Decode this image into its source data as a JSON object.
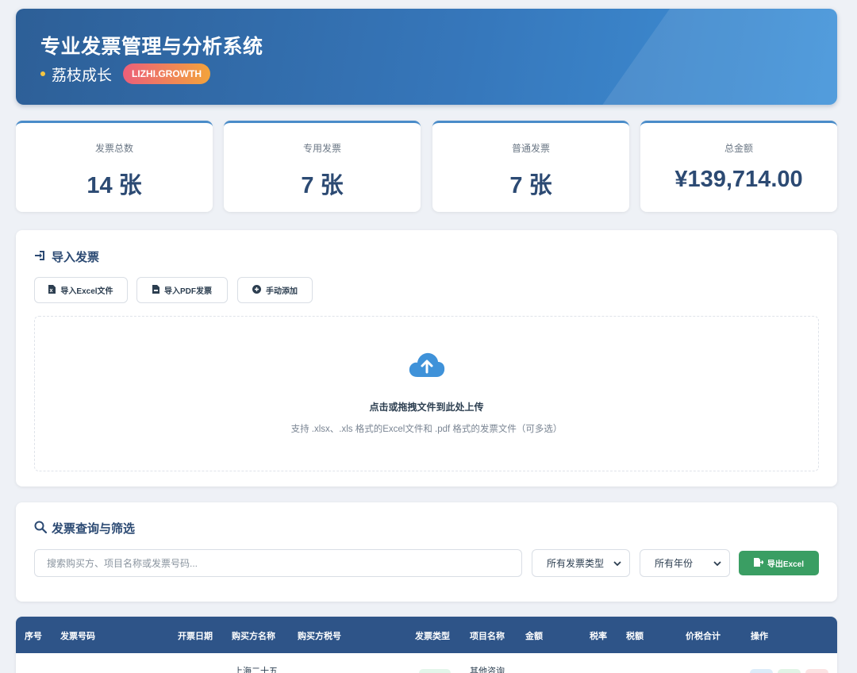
{
  "header": {
    "title": "专业发票管理与分析系统",
    "brand_name": "荔枝成长",
    "brand_badge": "LIZHI.GROWTH"
  },
  "stats": [
    {
      "label": "发票总数",
      "value": "14 张"
    },
    {
      "label": "专用发票",
      "value": "7 张"
    },
    {
      "label": "普通发票",
      "value": "7 张"
    },
    {
      "label": "总金额",
      "value": "¥139,714.00"
    }
  ],
  "import": {
    "title": "导入发票",
    "buttons": {
      "excel": "导入Excel文件",
      "pdf": "导入PDF发票",
      "manual": "手动添加"
    },
    "dropzone": {
      "main": "点击或拖拽文件到此处上传",
      "sub": "支持 .xlsx、.xls 格式的Excel文件和 .pdf 格式的发票文件（可多选）"
    }
  },
  "query": {
    "title": "发票查询与筛选",
    "search_placeholder": "搜索购买方、项目名称或发票号码...",
    "type_select": "所有发票类型",
    "year_select": "所有年份",
    "export_label": "导出Excel"
  },
  "table": {
    "columns": [
      "序号",
      "发票号码",
      "开票日期",
      "购买方名称",
      "购买方税号",
      "发票类型",
      "项目名称",
      "金额",
      "税率",
      "税额",
      "价税合计",
      "操作"
    ],
    "first_row": {
      "buyer": "上海二十五",
      "item": "其他咨询"
    }
  },
  "colors": {
    "header_start": "#2d5f97",
    "header_end": "#3f92d9",
    "accent": "#2c4a73",
    "export_green": "#3a9e63",
    "table_head": "#2e5488"
  }
}
